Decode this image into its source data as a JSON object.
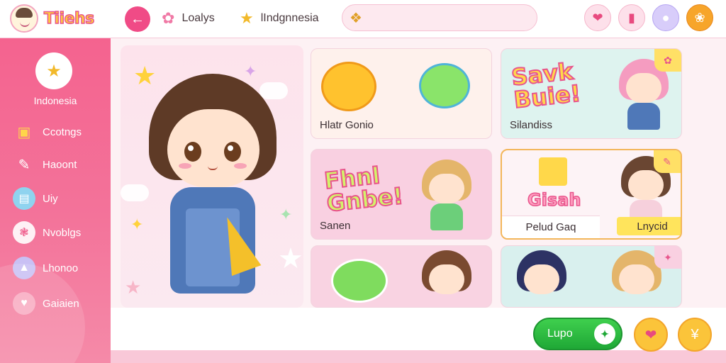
{
  "app": {
    "logo_text": "Tiiehs",
    "back_icon": "arrow-left-icon"
  },
  "header": {
    "nav": [
      {
        "label": "Loalys",
        "icon": "flower-icon",
        "color": "#f07aa6"
      },
      {
        "label": "lIndgnnesia",
        "icon": "star-face-icon",
        "color": "#f2b92a"
      }
    ],
    "search": {
      "value": "",
      "placeholder": "",
      "icon": "puzzle-icon"
    },
    "actions": [
      "heart-gift-icon",
      "card-icon",
      "chat-bubble-icon",
      "flower-badge-icon"
    ]
  },
  "sidebar": {
    "title": "Indonesia",
    "items": [
      {
        "label": "Ccotngs",
        "icon": "chest-icon"
      },
      {
        "label": "Haoont",
        "icon": "pencil-icon"
      },
      {
        "label": "Uiy",
        "icon": "tv-icon"
      },
      {
        "label": "Nvoblgs",
        "icon": "swirl-icon"
      },
      {
        "label": "Lhonoo",
        "icon": "ghost-icon"
      },
      {
        "label": "Gaiaien",
        "icon": "heart-icon"
      }
    ]
  },
  "cards": [
    {
      "label": "Hlatr Gonio"
    },
    {
      "label": "Silandiss",
      "headline": "Savk Buie!"
    },
    {
      "label": "Sanen",
      "headline": "Fhnl Gnbe!"
    },
    {
      "label_a": "Pelud Gaq",
      "label_b": "Lnycid",
      "headline": "Gisah"
    },
    {
      "label": ""
    },
    {
      "label": ""
    }
  ],
  "footer": {
    "primary_label": "Lupo",
    "actions": [
      "ribbon-icon",
      "coin-icon"
    ]
  },
  "colors": {
    "accent": "#f04b86",
    "sidebar": "#f4638f",
    "cta": "#2bbd43",
    "gold": "#fbc43a"
  }
}
